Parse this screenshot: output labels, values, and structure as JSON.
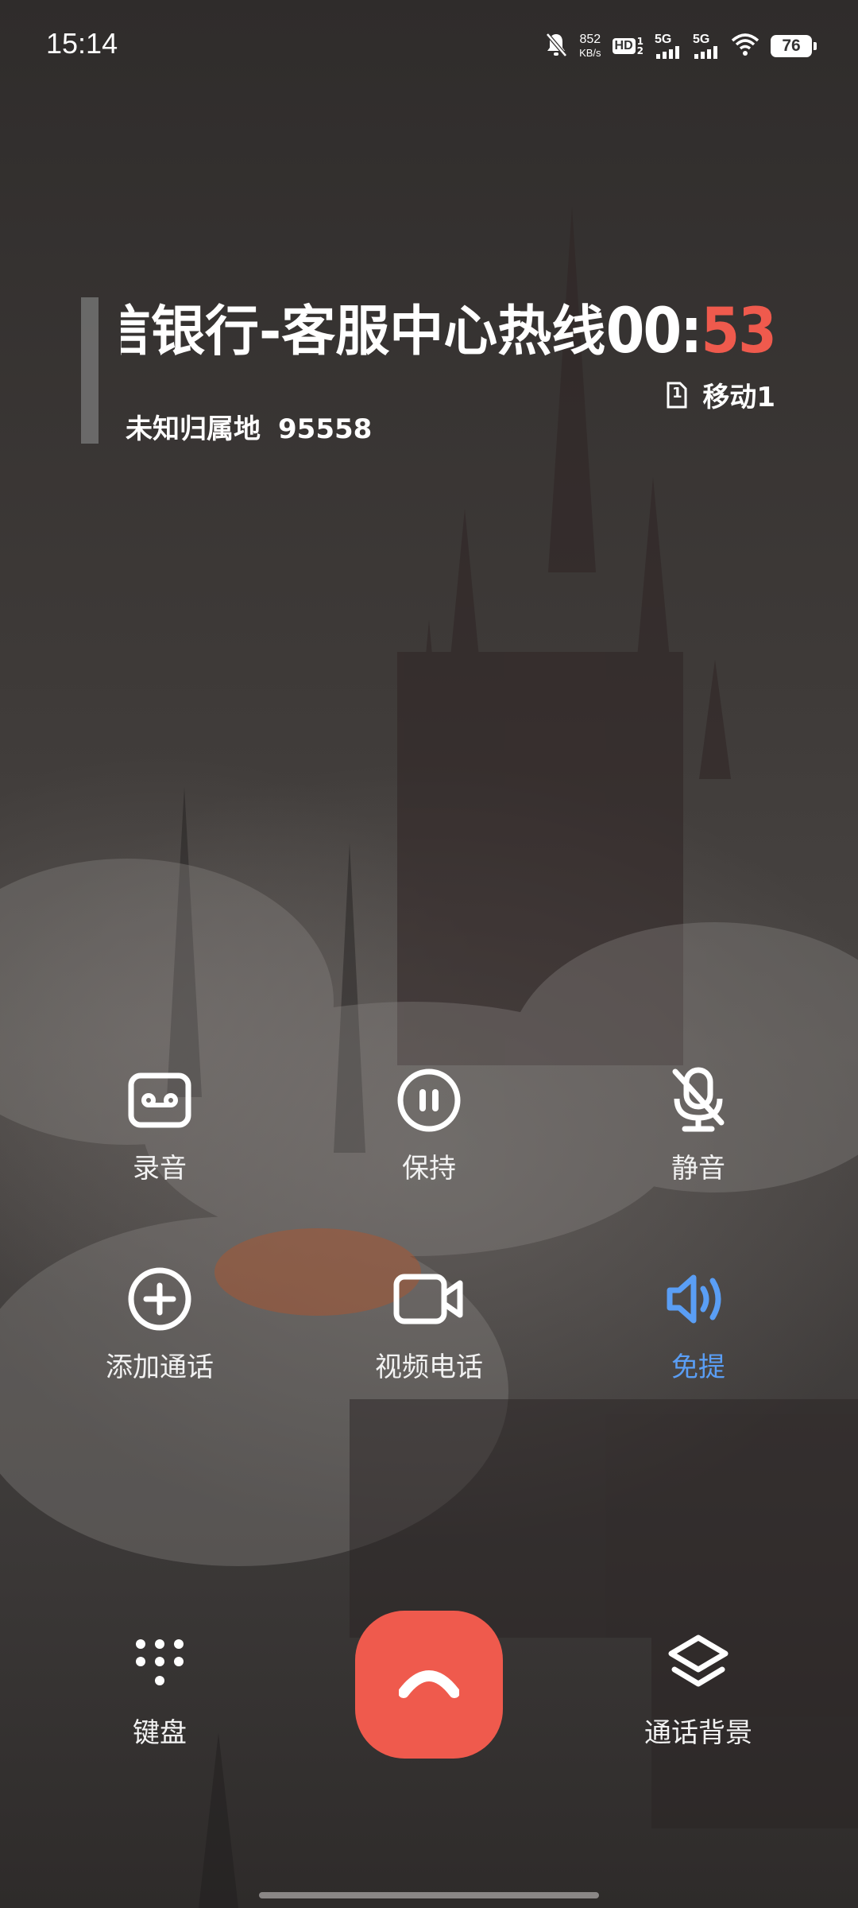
{
  "status_bar": {
    "time": "15:14",
    "net_speed_value": "852",
    "net_speed_unit": "KB/s",
    "hd_label": "HD",
    "sim1_network": "5G",
    "sim2_network": "5G",
    "battery": "76"
  },
  "caller": {
    "name": "信银行-客服中心热线",
    "location": "未知归属地",
    "number": "95558"
  },
  "call": {
    "timer_minutes": "00:",
    "timer_seconds": "53",
    "sim_slot": "1",
    "carrier": "移动1"
  },
  "controls": {
    "record": "录音",
    "hold": "保持",
    "mute": "静音",
    "add_call": "添加通话",
    "video_call": "视频电话",
    "speaker": "免提",
    "keypad": "键盘",
    "call_background": "通话背景"
  },
  "colors": {
    "end_call": "#ef5a4d",
    "speaker_active": "#5a9ef5",
    "timer_seconds": "#ef5a4d"
  },
  "icons": {
    "record": "record-tape-icon",
    "hold": "pause-icon",
    "mute": "mic-off-icon",
    "add_call": "plus-circle-icon",
    "video_call": "video-camera-icon",
    "speaker": "speaker-icon",
    "keypad": "dialpad-icon",
    "call_background": "layers-icon",
    "end_call": "hang-up-icon"
  }
}
